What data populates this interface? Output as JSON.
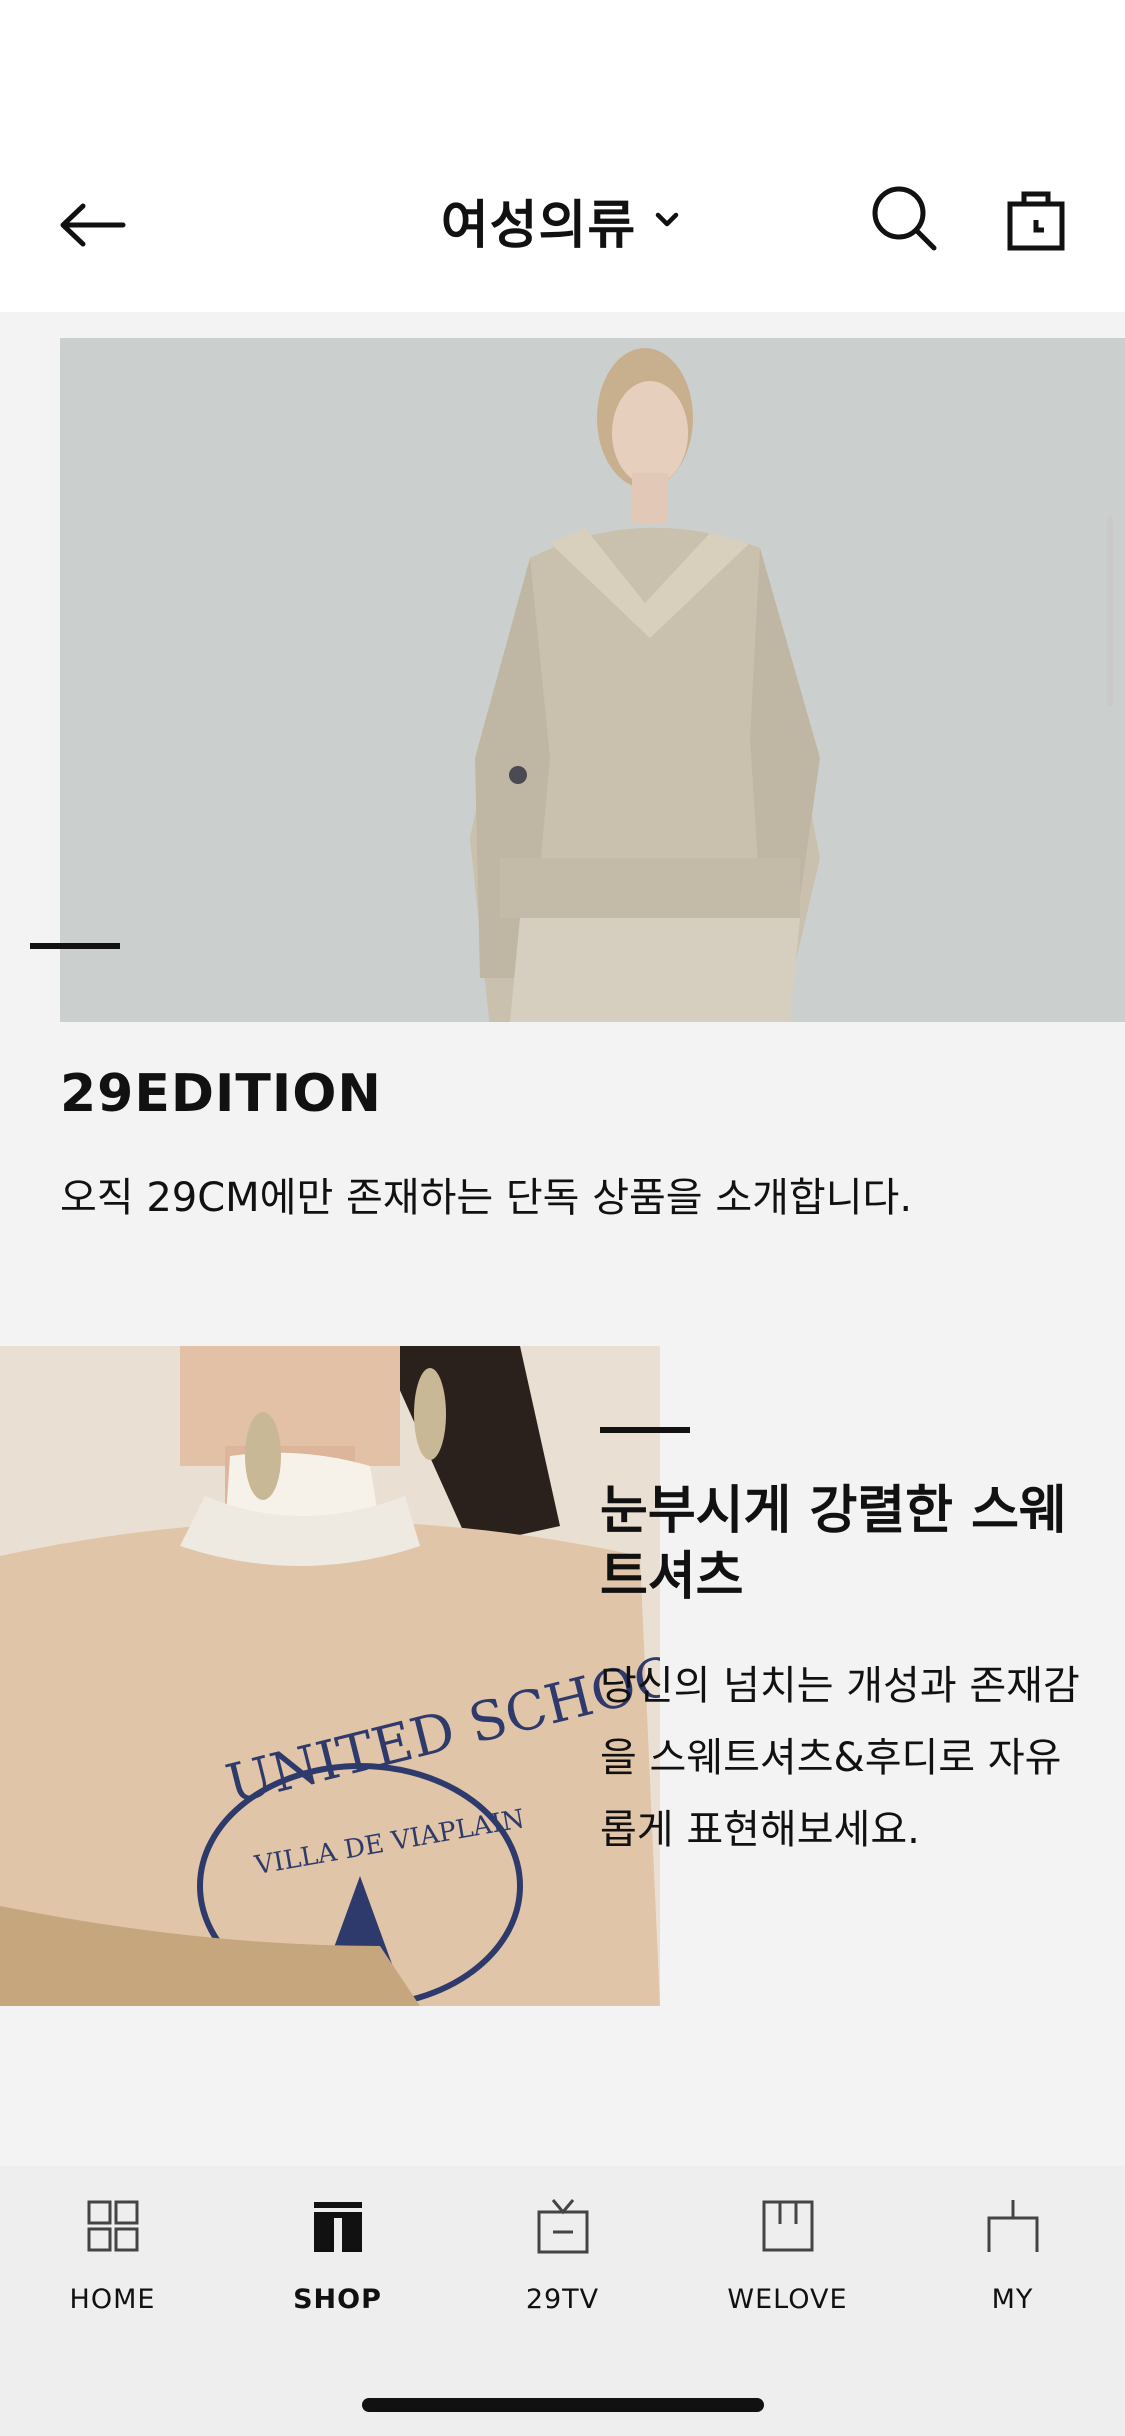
{
  "header": {
    "title": "여성의류"
  },
  "feature": {
    "title": "29EDITION",
    "description": "오직 29CM에만 존재하는 단독 상품을 소개합니다."
  },
  "promo": {
    "title": "눈부시게 강렬한 스웨트셔츠",
    "description": "당신의 넘치는 개성과 존재감을 스웨트셔츠&후디로 자유롭게 표현해보세요.",
    "sweatshirt_print_top": "UNITED SCHOOL",
    "sweatshirt_print_seal": "VILLA DE VIAPLAIN"
  },
  "tabbar": {
    "items": [
      {
        "label": "HOME"
      },
      {
        "label": "SHOP"
      },
      {
        "label": "29TV"
      },
      {
        "label": "WELOVE"
      },
      {
        "label": "MY"
      }
    ],
    "active_index": 1
  },
  "colors": {
    "text": "#111111",
    "page_bg": "#f3f3f3",
    "tabbar_bg": "#eeeeee"
  }
}
